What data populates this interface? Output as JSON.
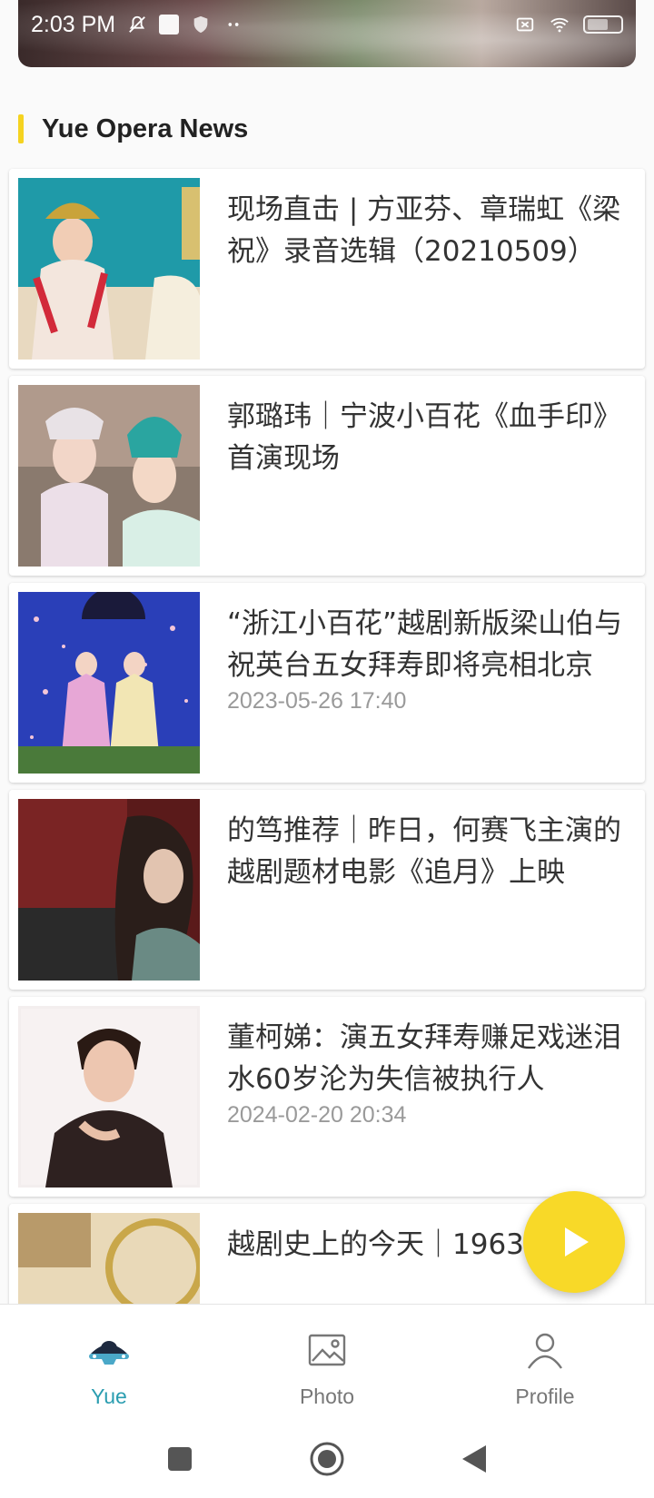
{
  "status_bar": {
    "time": "2:03 PM"
  },
  "section": {
    "title": "Yue Opera News"
  },
  "news": [
    {
      "title": "现场直击 | 方亚芬、章瑞虹《梁祝》录音选辑（20210509）",
      "date": ""
    },
    {
      "title": "郭璐玮｜宁波小百花《血手印》首演现场",
      "date": ""
    },
    {
      "title": "“浙江小百花”越剧新版梁山伯与祝英台五女拜寿即将亮相北京",
      "date": "2023-05-26 17:40"
    },
    {
      "title": "的笃推荐｜昨日，何赛飞主演的越剧题材电影《追月》上映",
      "date": ""
    },
    {
      "title": "董柯娣：演五女拜寿赚足戏迷泪水60岁沦为失信被执行人",
      "date": "2024-02-20 20:34"
    },
    {
      "title": "越剧史上的今天｜1963年3月",
      "date": ""
    }
  ],
  "fab": {
    "icon": "play-icon"
  },
  "bottom_nav": {
    "items": [
      {
        "label": "Yue",
        "icon": "opera-mask-icon",
        "active": true
      },
      {
        "label": "Photo",
        "icon": "image-icon",
        "active": false
      },
      {
        "label": "Profile",
        "icon": "person-icon",
        "active": false
      }
    ]
  },
  "colors": {
    "accent": "#f5d320",
    "active_tab": "#2a9db0",
    "fab": "#f8d928"
  }
}
